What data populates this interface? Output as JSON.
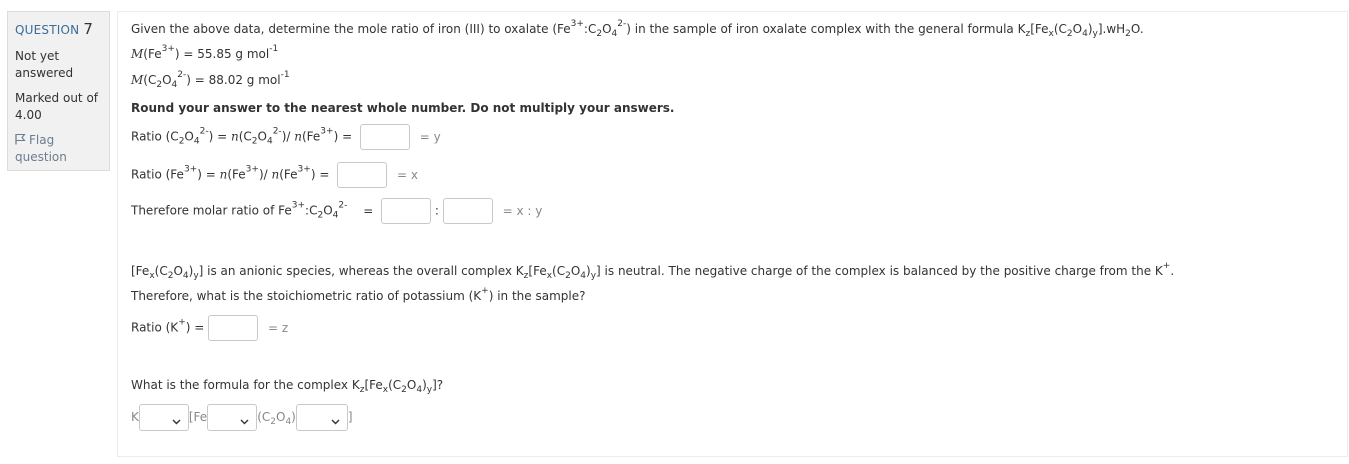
{
  "info": {
    "question_label": "QUESTION",
    "question_number": "7",
    "state_line1": "Not yet",
    "state_line2": "answered",
    "grade_line1": "Marked out of",
    "grade_line2": "4.00",
    "flag_line1": "Flag",
    "flag_line2": "question"
  },
  "q": {
    "intro_a": "Given the above data, determine the mole ratio of iron (III) to oxalate (Fe",
    "intro_b": ":C",
    "intro_c": "O",
    "intro_d": ") in the sample of iron oxalate complex with the general formula K",
    "intro_e": "[Fe",
    "intro_f": "(C",
    "intro_g": "O",
    "intro_h": ")",
    "intro_i": "].wH",
    "intro_j": "O.",
    "m_fe_a": "M",
    "m_fe_b": "(Fe",
    "m_fe_c": ") = 55.85 g mol",
    "m_ox_a": "M",
    "m_ox_b": "(C",
    "m_ox_c": "O",
    "m_ox_d": ") = 88.02 g mol",
    "round_note": "Round your answer to the nearest whole number. Do not multiply your answers.",
    "r1_a": "Ratio (C",
    "r1_b": "O",
    "r1_c": ")  =",
    "r1_d": "n",
    "r1_e": "(C",
    "r1_f": "O",
    "r1_g": ")/",
    "r1_h": "n",
    "r1_i": "(Fe",
    "r1_j": ")  =",
    "r1_k": "= y",
    "r2_a": "Ratio (Fe",
    "r2_b": ")  =",
    "r2_c": "n",
    "r2_d": "(Fe",
    "r2_e": ")/",
    "r2_f": "n",
    "r2_g": "(Fe",
    "r2_h": ")  =",
    "r2_i": "= x",
    "r3_a": "Therefore molar ratio of Fe",
    "r3_b": ":C",
    "r3_c": "O",
    "r3_d": "=",
    "r3_e": ":",
    "r3_f": "= x : y",
    "sp_a": "[Fe",
    "sp_b": "(C",
    "sp_c": "O",
    "sp_d": ")",
    "sp_e": "] is an anionic species, whereas the overall complex K",
    "sp_f": "[Fe",
    "sp_g": "(C",
    "sp_h": "O",
    "sp_i": ")",
    "sp_j": "] is neutral. The negative charge of the complex is balanced by the positive charge from the K",
    "sp_k": ".",
    "k_q_a": "Therefore, what is the stoichiometric ratio of potassium (K",
    "k_q_b": ") in the sample?",
    "k_r_a": "Ratio (K",
    "k_r_b": ") =",
    "k_r_c": "= z",
    "f_q_a": "What is the formula for the complex K",
    "f_q_b": "[Fe",
    "f_q_c": "(C",
    "f_q_d": "O",
    "f_q_e": ")",
    "f_q_f": "]?",
    "f_k": "K",
    "f_fe": "[Fe",
    "f_ox_a": "(C",
    "f_ox_b": "O",
    "f_ox_c": ")",
    "f_end": "]",
    "sup_3p": "3+",
    "sup_2m": "2-",
    "sup_m1": "-1",
    "sup_p": "+",
    "sub_2": "2",
    "sub_4": "4",
    "sub_x": "x",
    "sub_y": "y",
    "sub_z": "z"
  },
  "icons": {
    "flag": "flag-icon",
    "chevron": "chevron-down-icon"
  }
}
